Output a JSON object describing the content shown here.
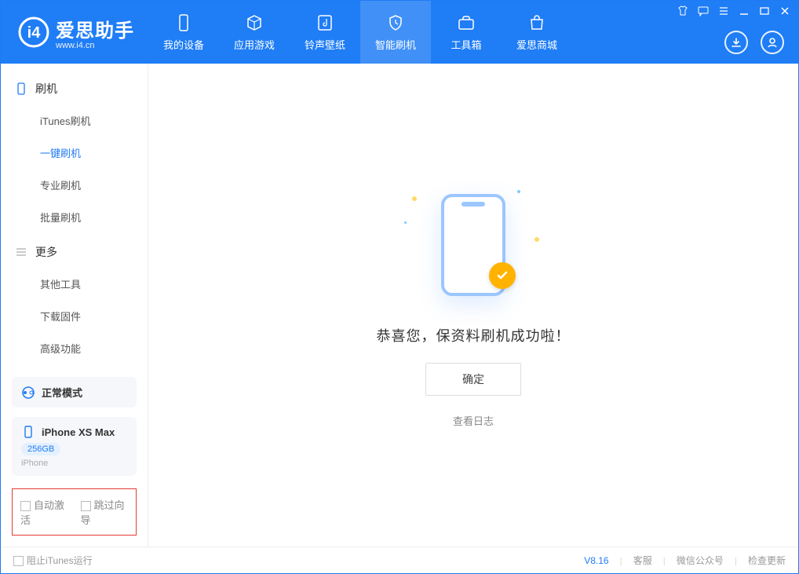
{
  "app": {
    "title": "爱思助手",
    "subtitle": "www.i4.cn"
  },
  "nav": {
    "tabs": [
      {
        "label": "我的设备",
        "icon": "device"
      },
      {
        "label": "应用游戏",
        "icon": "cube"
      },
      {
        "label": "铃声壁纸",
        "icon": "music"
      },
      {
        "label": "智能刷机",
        "icon": "shield",
        "active": true
      },
      {
        "label": "工具箱",
        "icon": "toolbox"
      },
      {
        "label": "爱思商城",
        "icon": "bag"
      }
    ]
  },
  "sidebar": {
    "sections": [
      {
        "title": "刷机",
        "icon": "device",
        "items": [
          "iTunes刷机",
          "一键刷机",
          "专业刷机",
          "批量刷机"
        ],
        "active_index": 1
      },
      {
        "title": "更多",
        "icon": "menu",
        "items": [
          "其他工具",
          "下载固件",
          "高级功能"
        ],
        "active_index": -1
      }
    ],
    "mode_card": {
      "label": "正常模式"
    },
    "device_card": {
      "name": "iPhone XS Max",
      "capacity": "256GB",
      "type": "iPhone"
    },
    "auto_row": {
      "opt1": "自动激活",
      "opt2": "跳过向导"
    }
  },
  "main": {
    "message": "恭喜您，保资料刷机成功啦！",
    "ok_label": "确定",
    "log_link": "查看日志"
  },
  "footer": {
    "block_itunes": "阻止iTunes运行",
    "version": "V8.16",
    "links": [
      "客服",
      "微信公众号",
      "检查更新"
    ]
  }
}
